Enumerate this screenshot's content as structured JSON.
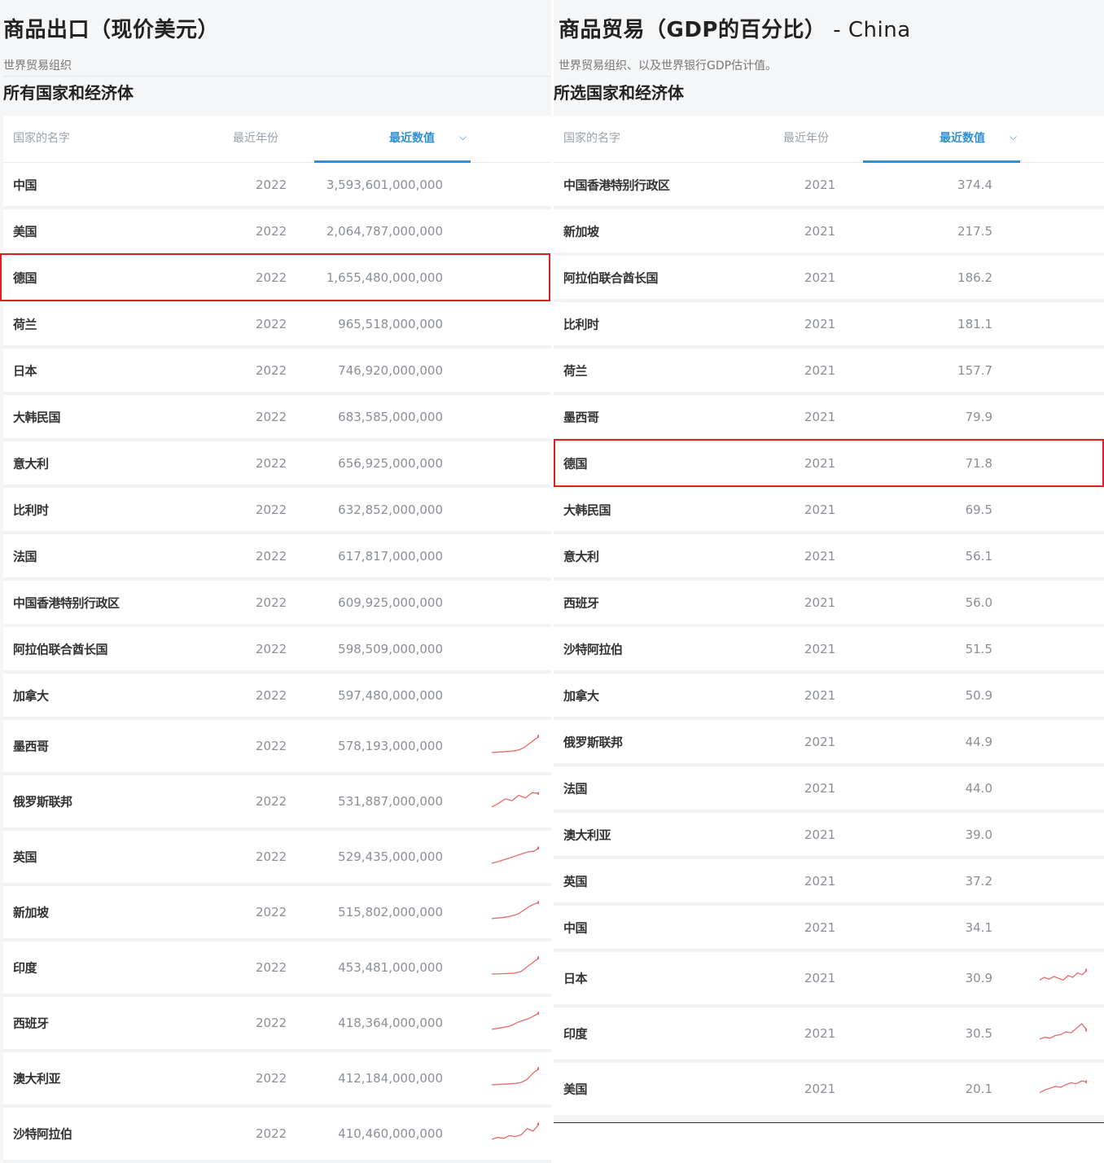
{
  "left": {
    "title": "商品出口（现价美元）",
    "source": "世界贸易组织",
    "subheading": "所有国家和经济体",
    "columns": {
      "name": "国家的名字",
      "year": "最近年份",
      "value": "最近数值"
    },
    "highlight_row": 2,
    "rows": [
      {
        "name": "中国",
        "year": "2022",
        "value": "3,593,601,000,000",
        "trend": null
      },
      {
        "name": "美国",
        "year": "2022",
        "value": "2,064,787,000,000",
        "trend": null
      },
      {
        "name": "德国",
        "year": "2022",
        "value": "1,655,480,000,000",
        "trend": null
      },
      {
        "name": "荷兰",
        "year": "2022",
        "value": "965,518,000,000",
        "trend": null
      },
      {
        "name": "日本",
        "year": "2022",
        "value": "746,920,000,000",
        "trend": null
      },
      {
        "name": "大韩民国",
        "year": "2022",
        "value": "683,585,000,000",
        "trend": null
      },
      {
        "name": "意大利",
        "year": "2022",
        "value": "656,925,000,000",
        "trend": null
      },
      {
        "name": "比利时",
        "year": "2022",
        "value": "632,852,000,000",
        "trend": null
      },
      {
        "name": "法国",
        "year": "2022",
        "value": "617,817,000,000",
        "trend": null
      },
      {
        "name": "中国香港特别行政区",
        "year": "2022",
        "value": "609,925,000,000",
        "trend": null
      },
      {
        "name": "阿拉伯联合酋长国",
        "year": "2022",
        "value": "598,509,000,000",
        "trend": null
      },
      {
        "name": "加拿大",
        "year": "2022",
        "value": "597,480,000,000",
        "trend": null
      },
      {
        "name": "墨西哥",
        "year": "2022",
        "value": "578,193,000,000",
        "trend": [
          0.05,
          0.06,
          0.08,
          0.1,
          0.12,
          0.15,
          0.22,
          0.35,
          0.55,
          0.75,
          0.95
        ]
      },
      {
        "name": "俄罗斯联邦",
        "year": "2022",
        "value": "531,887,000,000",
        "trend": [
          0.1,
          0.3,
          0.55,
          0.45,
          0.75,
          0.6,
          0.9,
          0.85
        ]
      },
      {
        "name": "英国",
        "year": "2022",
        "value": "529,435,000,000",
        "trend": [
          0.05,
          0.12,
          0.22,
          0.3,
          0.4,
          0.5,
          0.6,
          0.68,
          0.72,
          0.9
        ]
      },
      {
        "name": "新加坡",
        "year": "2022",
        "value": "515,802,000,000",
        "trend": [
          0.05,
          0.08,
          0.1,
          0.15,
          0.22,
          0.3,
          0.5,
          0.7,
          0.85,
          0.95
        ]
      },
      {
        "name": "印度",
        "year": "2022",
        "value": "453,481,000,000",
        "trend": [
          0.05,
          0.05,
          0.07,
          0.08,
          0.1,
          0.2,
          0.45,
          0.7,
          0.95
        ]
      },
      {
        "name": "西班牙",
        "year": "2022",
        "value": "418,364,000,000",
        "trend": [
          0.05,
          0.1,
          0.15,
          0.2,
          0.3,
          0.45,
          0.55,
          0.65,
          0.8,
          0.95
        ]
      },
      {
        "name": "澳大利亚",
        "year": "2022",
        "value": "412,184,000,000",
        "trend": [
          0.05,
          0.06,
          0.08,
          0.1,
          0.12,
          0.18,
          0.35,
          0.7,
          0.95
        ]
      },
      {
        "name": "沙特阿拉伯",
        "year": "2022",
        "value": "410,460,000,000",
        "trend": [
          0.1,
          0.2,
          0.15,
          0.3,
          0.25,
          0.35,
          0.7,
          0.55,
          0.95
        ]
      }
    ]
  },
  "right": {
    "title": "商品贸易（GDP的百分比）",
    "title_suffix": " - China",
    "source": "世界贸易组织、以及世界银行GDP估计值。",
    "subheading": "所选国家和经济体",
    "columns": {
      "name": "国家的名字",
      "year": "最近年份",
      "value": "最近数值"
    },
    "highlight_row": 6,
    "rows": [
      {
        "name": "中国香港特别行政区",
        "year": "2021",
        "value": "374.4",
        "trend": null
      },
      {
        "name": "新加坡",
        "year": "2021",
        "value": "217.5",
        "trend": null
      },
      {
        "name": "阿拉伯联合酋长国",
        "year": "2021",
        "value": "186.2",
        "trend": null
      },
      {
        "name": "比利时",
        "year": "2021",
        "value": "181.1",
        "trend": null
      },
      {
        "name": "荷兰",
        "year": "2021",
        "value": "157.7",
        "trend": null
      },
      {
        "name": "墨西哥",
        "year": "2021",
        "value": "79.9",
        "trend": null
      },
      {
        "name": "德国",
        "year": "2021",
        "value": "71.8",
        "trend": null
      },
      {
        "name": "大韩民国",
        "year": "2021",
        "value": "69.5",
        "trend": null
      },
      {
        "name": "意大利",
        "year": "2021",
        "value": "56.1",
        "trend": null
      },
      {
        "name": "西班牙",
        "year": "2021",
        "value": "56.0",
        "trend": null
      },
      {
        "name": "沙特阿拉伯",
        "year": "2021",
        "value": "51.5",
        "trend": null
      },
      {
        "name": "加拿大",
        "year": "2021",
        "value": "50.9",
        "trend": null
      },
      {
        "name": "俄罗斯联邦",
        "year": "2021",
        "value": "44.9",
        "trend": null
      },
      {
        "name": "法国",
        "year": "2021",
        "value": "44.0",
        "trend": null
      },
      {
        "name": "澳大利亚",
        "year": "2021",
        "value": "39.0",
        "trend": null
      },
      {
        "name": "英国",
        "year": "2021",
        "value": "37.2",
        "trend": null
      },
      {
        "name": "中国",
        "year": "2021",
        "value": "34.1",
        "trend": null
      },
      {
        "name": "日本",
        "year": "2021",
        "value": "30.9",
        "trend": [
          0.3,
          0.45,
          0.35,
          0.5,
          0.4,
          0.3,
          0.55,
          0.45,
          0.7,
          0.6,
          0.85
        ]
      },
      {
        "name": "印度",
        "year": "2021",
        "value": "30.5",
        "trend": [
          0.1,
          0.2,
          0.15,
          0.3,
          0.35,
          0.5,
          0.45,
          0.7,
          0.95,
          0.6
        ]
      },
      {
        "name": "美国",
        "year": "2021",
        "value": "20.1",
        "trend": [
          0.2,
          0.35,
          0.45,
          0.55,
          0.5,
          0.65,
          0.75,
          0.7,
          0.85,
          0.8
        ]
      }
    ]
  },
  "colors": {
    "accent": "#2e8fd6",
    "highlight": "#e02020",
    "spark": "#e76a6a"
  }
}
